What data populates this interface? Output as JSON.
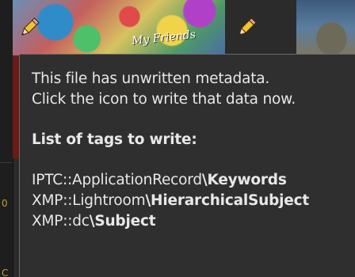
{
  "thumbnails": [
    {
      "name": "thumbnail-1",
      "overlay_text": "My Friends",
      "icon": "pencil-icon"
    },
    {
      "name": "thumbnail-2",
      "icon": "pencil-icon"
    }
  ],
  "tooltip": {
    "line1": "This file has unwritten metadata.",
    "line2": "Click the icon to write that data now.",
    "heading": "List of tags to write:",
    "tags": [
      {
        "prefix": "IPTC::ApplicationRecord",
        "name": "\\Keywords"
      },
      {
        "prefix": "XMP::Lightroom",
        "name": "\\HierarchicalSubject"
      },
      {
        "prefix": "XMP::dc",
        "name": "\\Subject"
      }
    ]
  },
  "left_strip_glyphs": [
    "0",
    "C"
  ],
  "colors": {
    "background": "#2b2b2b",
    "tooltip_bg": "#2f2f2f",
    "tooltip_border": "#6a6a6a",
    "tooltip_text": "#e8e8e8",
    "pencil_body": "#f2c230"
  }
}
